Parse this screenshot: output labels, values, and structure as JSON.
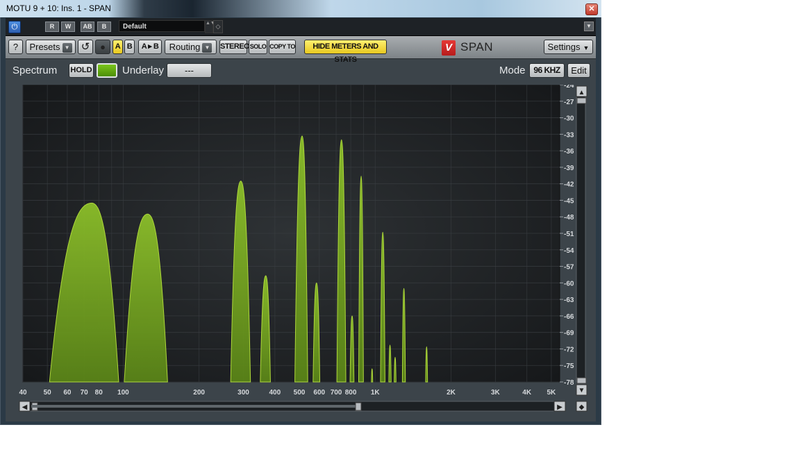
{
  "window": {
    "title": "MOTU 9 + 10: Ins. 1 - SPAN",
    "close_glyph": "✕"
  },
  "host_bar": {
    "power_icon": "power-icon",
    "read_label": "R",
    "write_label": "W",
    "ab_label": "AB",
    "bypass_label": "B",
    "preset_value": "Default",
    "spin_glyph": "▲▼",
    "diamond_glyph": "◇",
    "menu_glyph": "▼"
  },
  "toolbar": {
    "help_label": "?",
    "presets_label": "Presets",
    "dropdown_glyph": "▼",
    "reset_glyph": "↺",
    "a_label": "A",
    "b_label": "B",
    "a_to_b_label": "A ▸ B",
    "routing_label": "Routing",
    "stereo_label": "STEREO",
    "solo_label": "SOLO",
    "copy_to_label": "COPY TO",
    "hide_meters_label": "HIDE METERS AND STATS",
    "brand_mark": "V",
    "brand_name": "SPAN",
    "settings_label": "Settings",
    "settings_glyph": "▼"
  },
  "spectrum_bar": {
    "spectrum_label": "Spectrum",
    "hold_label": "HOLD",
    "underlay_label": "Underlay",
    "underlay_value": "---",
    "mode_label": "Mode",
    "mode_value": "96 KHZ",
    "edit_label": "Edit"
  },
  "scroll": {
    "left_glyph": "◀",
    "right_glyph": "▶",
    "up_glyph": "▲",
    "down_glyph": "▼",
    "corner_glyph": "◆"
  },
  "colors": {
    "spectrum_fill": "#6f9d1e",
    "spectrum_stroke": "#b6e13c",
    "plot_bg": "#1b1d1f",
    "grid": "#3a3e42",
    "accent_yellow": "#f6dc2c",
    "hold_green": "#66b014"
  },
  "chart_data": {
    "type": "area",
    "x_scale": "log",
    "xlim": [
      40,
      5400
    ],
    "ylim": [
      -78,
      -24
    ],
    "grid": true,
    "x_ticks": [
      {
        "v": 40,
        "label": "40"
      },
      {
        "v": 50,
        "label": "50"
      },
      {
        "v": 60,
        "label": "60"
      },
      {
        "v": 70,
        "label": "70"
      },
      {
        "v": 80,
        "label": "80"
      },
      {
        "v": 100,
        "label": "100"
      },
      {
        "v": 200,
        "label": "200"
      },
      {
        "v": 300,
        "label": "300"
      },
      {
        "v": 400,
        "label": "400"
      },
      {
        "v": 500,
        "label": "500"
      },
      {
        "v": 600,
        "label": "600"
      },
      {
        "v": 700,
        "label": "700"
      },
      {
        "v": 800,
        "label": "800"
      },
      {
        "v": 1000,
        "label": "1K"
      },
      {
        "v": 2000,
        "label": "2K"
      },
      {
        "v": 3000,
        "label": "3K"
      },
      {
        "v": 4000,
        "label": "4K"
      },
      {
        "v": 5000,
        "label": "5K"
      }
    ],
    "y_ticks": [
      -24,
      -27,
      -30,
      -33,
      -36,
      -39,
      -42,
      -45,
      -48,
      -51,
      -54,
      -57,
      -60,
      -63,
      -66,
      -69,
      -72,
      -75,
      -78
    ],
    "peaks": [
      {
        "freq": 75,
        "level": -45.5,
        "low": 51,
        "high": 96
      },
      {
        "freq": 125,
        "level": -47.5,
        "low": 101,
        "high": 150
      },
      {
        "freq": 293,
        "level": -41.5,
        "low": 267,
        "high": 320
      },
      {
        "freq": 368,
        "level": -58.7,
        "low": 350,
        "high": 384
      },
      {
        "freq": 513,
        "level": -33.3,
        "low": 480,
        "high": 540
      },
      {
        "freq": 585,
        "level": -60.0,
        "low": 567,
        "high": 603
      },
      {
        "freq": 735,
        "level": -34.0,
        "low": 705,
        "high": 765
      },
      {
        "freq": 810,
        "level": -66.0,
        "low": 795,
        "high": 824
      },
      {
        "freq": 880,
        "level": -40.6,
        "low": 860,
        "high": 898
      },
      {
        "freq": 972,
        "level": -75.6,
        "low": 966,
        "high": 978
      },
      {
        "freq": 1072,
        "level": -50.8,
        "low": 1050,
        "high": 1094
      },
      {
        "freq": 1145,
        "level": -71.3,
        "low": 1133,
        "high": 1157
      },
      {
        "freq": 1200,
        "level": -73.5,
        "low": 1190,
        "high": 1210
      },
      {
        "freq": 1300,
        "level": -61.0,
        "low": 1282,
        "high": 1318
      },
      {
        "freq": 1600,
        "level": -71.6,
        "low": 1586,
        "high": 1614
      }
    ]
  }
}
